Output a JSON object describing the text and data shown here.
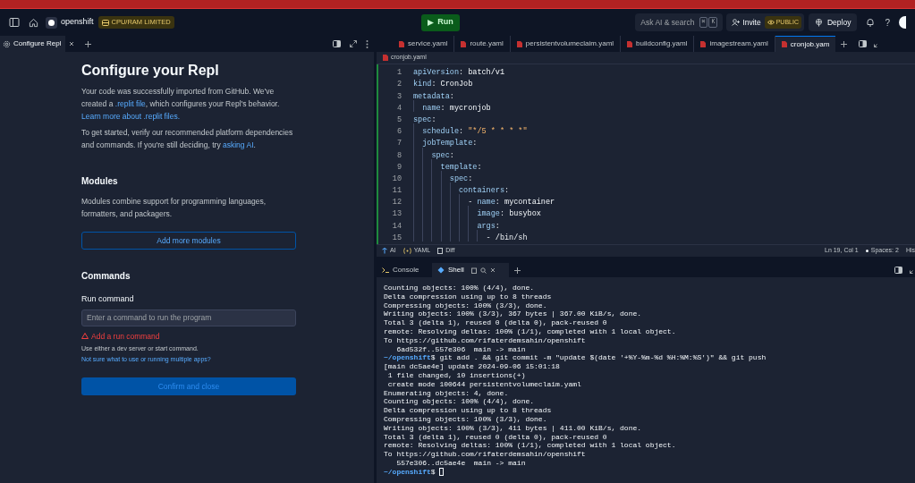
{
  "top_bar": {
    "repl_name": "openshift",
    "badge": "CPU/RAM LIMITED",
    "run_button": "Run",
    "search": {
      "placeholder": "Ask AI & search",
      "keys": [
        "⌘",
        "K"
      ]
    },
    "invite_button": "Invite",
    "visibility_badge": "PUBLIC",
    "deploy_button": "Deploy",
    "help": "?"
  },
  "left_pane": {
    "tabs": [
      {
        "label": "Configure Repl",
        "selected": true
      }
    ],
    "title": "Configure your Repl",
    "intro": [
      [
        {
          "kind": "text",
          "text": "Your code was successfully imported from GitHub. We've created a "
        },
        {
          "kind": "link",
          "text": ".replit file"
        },
        {
          "kind": "text",
          "text": ", which configures your Repl's behavior."
        },
        {
          "kind": "link",
          "text": "Learn more about .replit files.",
          "new_line": true
        }
      ],
      [
        {
          "kind": "text",
          "text": "To get started, verify our recommended platform dependencies and commands. If you're still deciding, try "
        },
        {
          "kind": "link",
          "text": "asking AI"
        },
        {
          "kind": "text",
          "text": "."
        }
      ]
    ],
    "modules": {
      "heading": "Modules",
      "description": "Modules combine support for programming languages, formatters, and packagers.",
      "button": "Add more modules"
    },
    "commands": {
      "heading": "Commands",
      "run_label": "Run command",
      "run_placeholder": "Enter a command to run the program",
      "error": "Add a run command",
      "hint": "Use either a dev server or start command.",
      "link": "Not sure what to use or running multiple apps?"
    },
    "confirm_button": "Confirm and close"
  },
  "editor": {
    "tabs": [
      {
        "label": "service.yaml",
        "selected": false
      },
      {
        "label": "route.yaml",
        "selected": false
      },
      {
        "label": "persistentvolumeclaim.yaml",
        "selected": false
      },
      {
        "label": "buildconfig.yaml",
        "selected": false
      },
      {
        "label": "imagestream.yaml",
        "selected": false
      },
      {
        "label": "cronjob.yam",
        "selected": true
      }
    ],
    "breadcrumb": "cronjob.yaml",
    "lines": [
      {
        "number": "1",
        "tokens": [
          {
            "kind": "key",
            "text": "apiVersion"
          },
          {
            "kind": "plain",
            "text": ": "
          },
          {
            "kind": "value",
            "text": "batch/v1"
          }
        ]
      },
      {
        "number": "2",
        "tokens": [
          {
            "kind": "key",
            "text": "kind"
          },
          {
            "kind": "plain",
            "text": ": "
          },
          {
            "kind": "value",
            "text": "CronJob"
          }
        ]
      },
      {
        "number": "3",
        "tokens": [
          {
            "kind": "key",
            "text": "metadata"
          },
          {
            "kind": "plain",
            "text": ":"
          }
        ]
      },
      {
        "number": "4",
        "tokens": [
          {
            "kind": "key",
            "text": "  name"
          },
          {
            "kind": "plain",
            "text": ": "
          },
          {
            "kind": "value",
            "text": "mycronjob"
          }
        ]
      },
      {
        "number": "5",
        "tokens": [
          {
            "kind": "key",
            "text": "spec"
          },
          {
            "kind": "plain",
            "text": ":"
          }
        ]
      },
      {
        "number": "6",
        "tokens": [
          {
            "kind": "key",
            "text": "  schedule"
          },
          {
            "kind": "plain",
            "text": ": "
          },
          {
            "kind": "string",
            "text": "\"*/5 * * * *\""
          }
        ]
      },
      {
        "number": "7",
        "tokens": [
          {
            "kind": "key",
            "text": "  jobTemplate"
          },
          {
            "kind": "plain",
            "text": ":"
          }
        ]
      },
      {
        "number": "8",
        "tokens": [
          {
            "kind": "key",
            "text": "    spec"
          },
          {
            "kind": "plain",
            "text": ":"
          }
        ]
      },
      {
        "number": "9",
        "tokens": [
          {
            "kind": "key",
            "text": "      template"
          },
          {
            "kind": "plain",
            "text": ":"
          }
        ]
      },
      {
        "number": "10",
        "tokens": [
          {
            "kind": "key",
            "text": "        spec"
          },
          {
            "kind": "plain",
            "text": ":"
          }
        ]
      },
      {
        "number": "11",
        "tokens": [
          {
            "kind": "key",
            "text": "          containers"
          },
          {
            "kind": "plain",
            "text": ":"
          }
        ]
      },
      {
        "number": "12",
        "tokens": [
          {
            "kind": "plain",
            "text": "            - "
          },
          {
            "kind": "key",
            "text": "name"
          },
          {
            "kind": "plain",
            "text": ": "
          },
          {
            "kind": "value",
            "text": "mycontainer"
          }
        ]
      },
      {
        "number": "13",
        "tokens": [
          {
            "kind": "key",
            "text": "              image"
          },
          {
            "kind": "plain",
            "text": ": "
          },
          {
            "kind": "value",
            "text": "busybox"
          }
        ]
      },
      {
        "number": "14",
        "tokens": [
          {
            "kind": "key",
            "text": "              args"
          },
          {
            "kind": "plain",
            "text": ":"
          }
        ]
      },
      {
        "number": "15",
        "tokens": [
          {
            "kind": "plain",
            "text": "                - /bin/sh"
          }
        ]
      }
    ],
    "status": {
      "left": [
        "AI",
        "YAML",
        "Diff"
      ],
      "position": "Ln 19, Col 1",
      "spaces": "Spaces: 2",
      "history": "His"
    }
  },
  "terminal": {
    "tabs": [
      {
        "label": "Console",
        "selected": false
      },
      {
        "label": "Shell",
        "selected": true
      }
    ],
    "lines": [
      {
        "kind": "output",
        "text": "Counting objects: 100% (4/4), done."
      },
      {
        "kind": "output",
        "text": "Delta compression using up to 8 threads"
      },
      {
        "kind": "output",
        "text": "Compressing objects: 100% (3/3), done."
      },
      {
        "kind": "output",
        "text": "Writing objects: 100% (3/3), 367 bytes | 367.00 KiB/s, done."
      },
      {
        "kind": "output",
        "text": "Total 3 (delta 1), reused 0 (delta 0), pack-reused 0"
      },
      {
        "kind": "output",
        "text": "remote: Resolving deltas: 100% (1/1), completed with 1 local object."
      },
      {
        "kind": "output",
        "text": "To https://github.com/rifaterdemsahin/openshift"
      },
      {
        "kind": "output",
        "text": "   6ad532f..557e306  main -> main"
      },
      {
        "kind": "prompt",
        "prompt": "~/openshift",
        "text": "$ git add . && git commit -m \"update $(date '+%Y-%m-%d %H:%M:%S')\" && git push"
      },
      {
        "kind": "output",
        "text": "[main dc5ae4e] update 2024-09-06 15:01:18"
      },
      {
        "kind": "output",
        "text": " 1 file changed, 10 insertions(+)"
      },
      {
        "kind": "output",
        "text": " create mode 100644 persistentvolumeclaim.yaml"
      },
      {
        "kind": "output",
        "text": "Enumerating objects: 4, done."
      },
      {
        "kind": "output",
        "text": "Counting objects: 100% (4/4), done."
      },
      {
        "kind": "output",
        "text": "Delta compression using up to 8 threads"
      },
      {
        "kind": "output",
        "text": "Compressing objects: 100% (3/3), done."
      },
      {
        "kind": "output",
        "text": "Writing objects: 100% (3/3), 411 bytes | 411.00 KiB/s, done."
      },
      {
        "kind": "output",
        "text": "Total 3 (delta 1), reused 0 (delta 0), pack-reused 0"
      },
      {
        "kind": "output",
        "text": "remote: Resolving deltas: 100% (1/1), completed with 1 local object."
      },
      {
        "kind": "output",
        "text": "To https://github.com/rifaterdemsahin/openshift"
      },
      {
        "kind": "output",
        "text": "   557e306..dc5ae4e  main -> main"
      },
      {
        "kind": "prompt",
        "prompt": "~/openshift",
        "text": "$ ",
        "cursor": true
      }
    ]
  }
}
